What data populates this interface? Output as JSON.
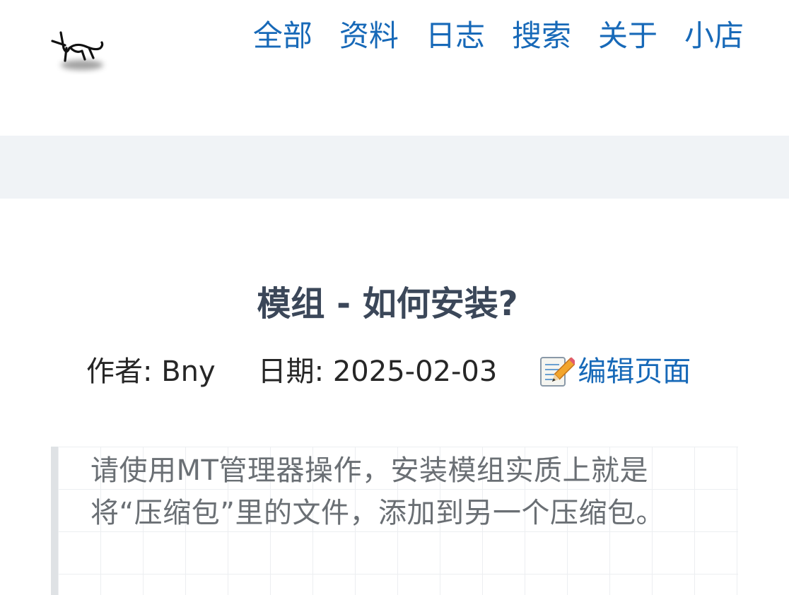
{
  "nav": {
    "items": [
      {
        "label": "全部"
      },
      {
        "label": "资料"
      },
      {
        "label": "日志"
      },
      {
        "label": "搜索"
      },
      {
        "label": "关于"
      },
      {
        "label": "小店"
      }
    ]
  },
  "logo": {
    "icon": "horse-sketch-icon"
  },
  "article": {
    "title": "模组 - 如何安装?",
    "author_label": "作者: Bny",
    "date_label": "日期: 2025-02-03",
    "edit_label": "编辑页面",
    "edit_icon": "memo-pencil-icon",
    "quote_text": "请使用MT管理器操作，安装模组实质上就是将“压缩包”里的文件，添加到另一个压缩包。"
  },
  "colors": {
    "link": "#1769b8",
    "title": "#3b4759",
    "band": "#f0f3f6",
    "quote_border": "#dfe2e5",
    "quote_text": "#6a6f74"
  }
}
